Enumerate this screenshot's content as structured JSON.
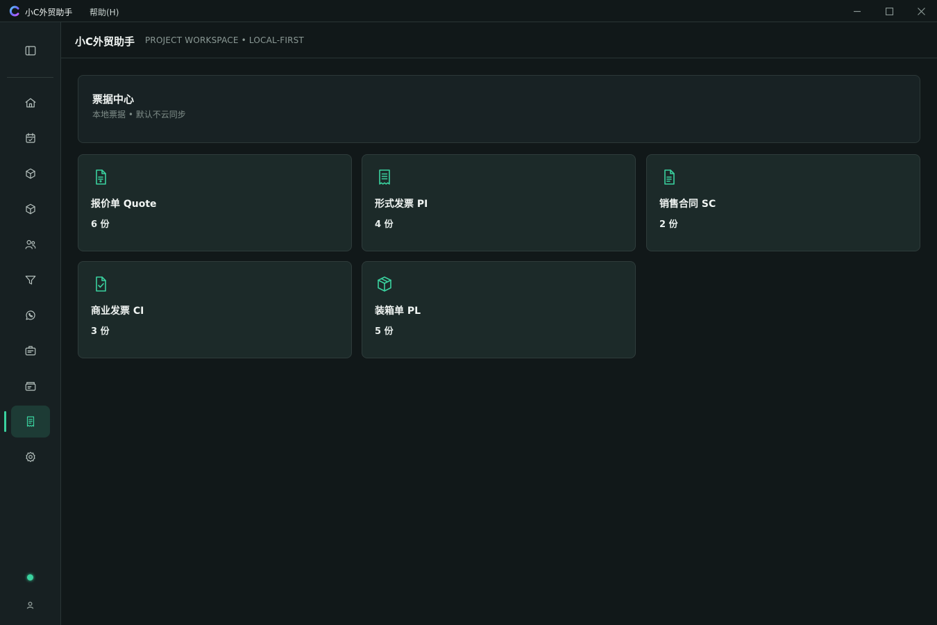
{
  "titlebar": {
    "app_name": "小C外贸助手",
    "menu_help": "帮助(H)"
  },
  "header": {
    "title": "小C外贸助手",
    "subtitle": "PROJECT WORKSPACE  •  LOCAL-FIRST"
  },
  "hero": {
    "title": "票据中心",
    "subtitle": "本地票据  •  默认不云同步"
  },
  "cards": [
    {
      "title": "报价单 Quote",
      "count": "6 份",
      "icon": "file-dollar-icon"
    },
    {
      "title": "形式发票 PI",
      "count": "4 份",
      "icon": "receipt-icon"
    },
    {
      "title": "销售合同 SC",
      "count": "2 份",
      "icon": "file-text-icon"
    },
    {
      "title": "商业发票 CI",
      "count": "3 份",
      "icon": "file-check-icon"
    },
    {
      "title": "装箱单 PL",
      "count": "5 份",
      "icon": "package-icon"
    }
  ],
  "sidebar": {
    "items": [
      "home-icon",
      "calendar-check-icon",
      "box-icon",
      "box-icon",
      "users-icon",
      "filter-icon",
      "whatsapp-icon",
      "briefcase-icon",
      "folder-card-icon",
      "receipt-icon",
      "settings-icon"
    ],
    "active_index": 9
  },
  "colors": {
    "accent": "#3ad29f",
    "background": "#111819",
    "card": "#1c2a29"
  }
}
